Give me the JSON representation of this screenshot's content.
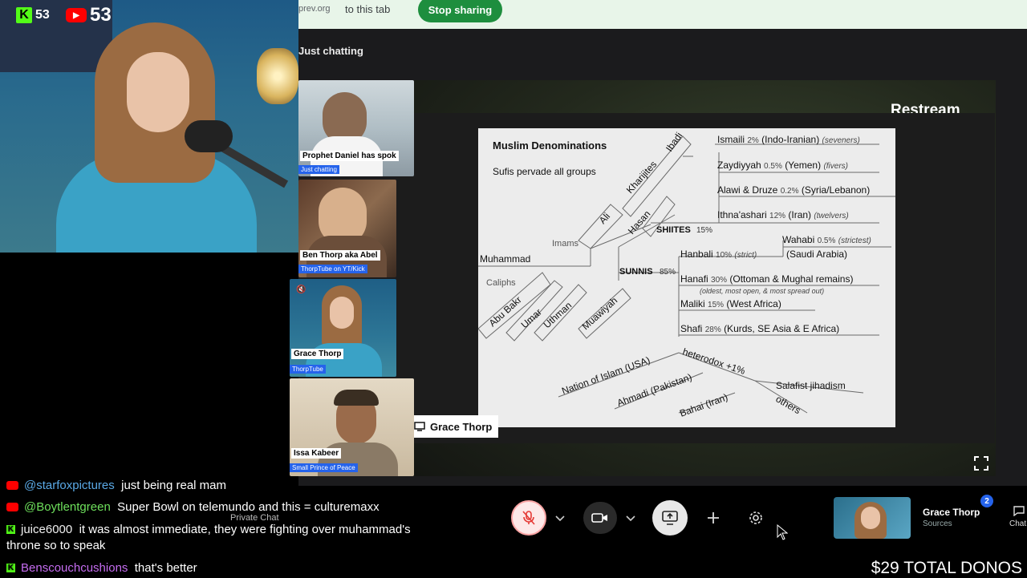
{
  "share_bar": {
    "url_fragment": "prev.org",
    "text": "to this tab",
    "stop_button": "Stop sharing"
  },
  "app": {
    "title": "Just chatting",
    "brand": "Restream"
  },
  "webcam": {
    "kick_count": "53",
    "youtube_count": "53"
  },
  "participants": [
    {
      "name": "Prophet Daniel has spok",
      "tag": "Just chatting"
    },
    {
      "name": "Ben Thorp aka Abel",
      "tag": "ThorpTube on YT/Kick"
    },
    {
      "name": "Grace Thorp",
      "tag": "ThorpTube"
    },
    {
      "name": "Issa Kabeer",
      "tag": "Small Prince of Peace"
    }
  ],
  "stage": {
    "presenter_label": "Grace Thorp"
  },
  "slide": {
    "title": "Muslim Denominations",
    "subtitle": "Sufis pervade all groups",
    "root": "Muhammad",
    "imams": "Imams",
    "caliphs": "Caliphs",
    "caliph_names": [
      "Abu Bakr",
      "Umar",
      "Uthman",
      "Muawiyah"
    ],
    "imam_names": [
      "Ali",
      "Hasan"
    ],
    "kharijites": "Kharijites",
    "ibadi": "Ibadi",
    "shiites": {
      "label": "SHIITES",
      "pct": "15%"
    },
    "sunnis": {
      "label": "SUNNIS",
      "pct": "85%"
    },
    "shia_branches": [
      {
        "name": "Ismaili",
        "pct": "2%",
        "region": "(Indo-Iranian)",
        "note": "(seveners)"
      },
      {
        "name": "Zaydiyyah",
        "pct": "0.5%",
        "region": "(Yemen)",
        "note": "(fivers)"
      },
      {
        "name": "Alawi & Druze",
        "pct": "0.2%",
        "region": "(Syria/Lebanon)",
        "note": ""
      },
      {
        "name": "Ithna'ashari",
        "pct": "12%",
        "region": "(Iran)",
        "note": "(twelvers)"
      }
    ],
    "wahabi": {
      "name": "Wahabi",
      "pct": "0.5%",
      "note": "(strictest)",
      "region": "(Saudi Arabia)"
    },
    "sunni_branches": [
      {
        "name": "Hanbali",
        "pct": "10%",
        "note": "(strict)",
        "region": ""
      },
      {
        "name": "Hanafi",
        "pct": "30%",
        "region": "(Ottoman & Mughal remains)",
        "note": "(oldest, most open, & most spread out)"
      },
      {
        "name": "Maliki",
        "pct": "15%",
        "region": "(West Africa)",
        "note": ""
      },
      {
        "name": "Shafi",
        "pct": "28%",
        "region": "(Kurds, SE Asia & E Africa)",
        "note": ""
      }
    ],
    "heterodox": "heterodox +1%",
    "heterodox_groups": [
      "Nation of Islam (USA)",
      "Ahmadi (Pakistan)",
      "Bahai (Iran)",
      "Salafist jihadism",
      "others"
    ]
  },
  "chat": [
    {
      "platform": "youtube",
      "user": "@starfoxpictures",
      "message": "just being real mam"
    },
    {
      "platform": "youtube",
      "user": "@Boytlentgreen",
      "message": "Super Bowl on telemundo and this = culturemaxx"
    },
    {
      "platform": "kick",
      "user": "juice6000",
      "message": "it was almost immediate, they were fighting over muhammad's",
      "message2": "throne so to speak"
    },
    {
      "platform": "kick",
      "user": "Benscouchcushions",
      "message": "that's better"
    }
  ],
  "controls": {
    "private_chat": "Private Chat",
    "me_name": "Grace Thorp",
    "me_sub": "Sources",
    "notif_count": "2",
    "chat_label": "Chat"
  },
  "overlay": {
    "donos": "$29 TOTAL DONOS"
  },
  "colors": {
    "accent_blue": "#2563eb",
    "stop_green": "#1e8e3e",
    "kick_green": "#53fc18",
    "youtube_red": "#ff0000"
  }
}
